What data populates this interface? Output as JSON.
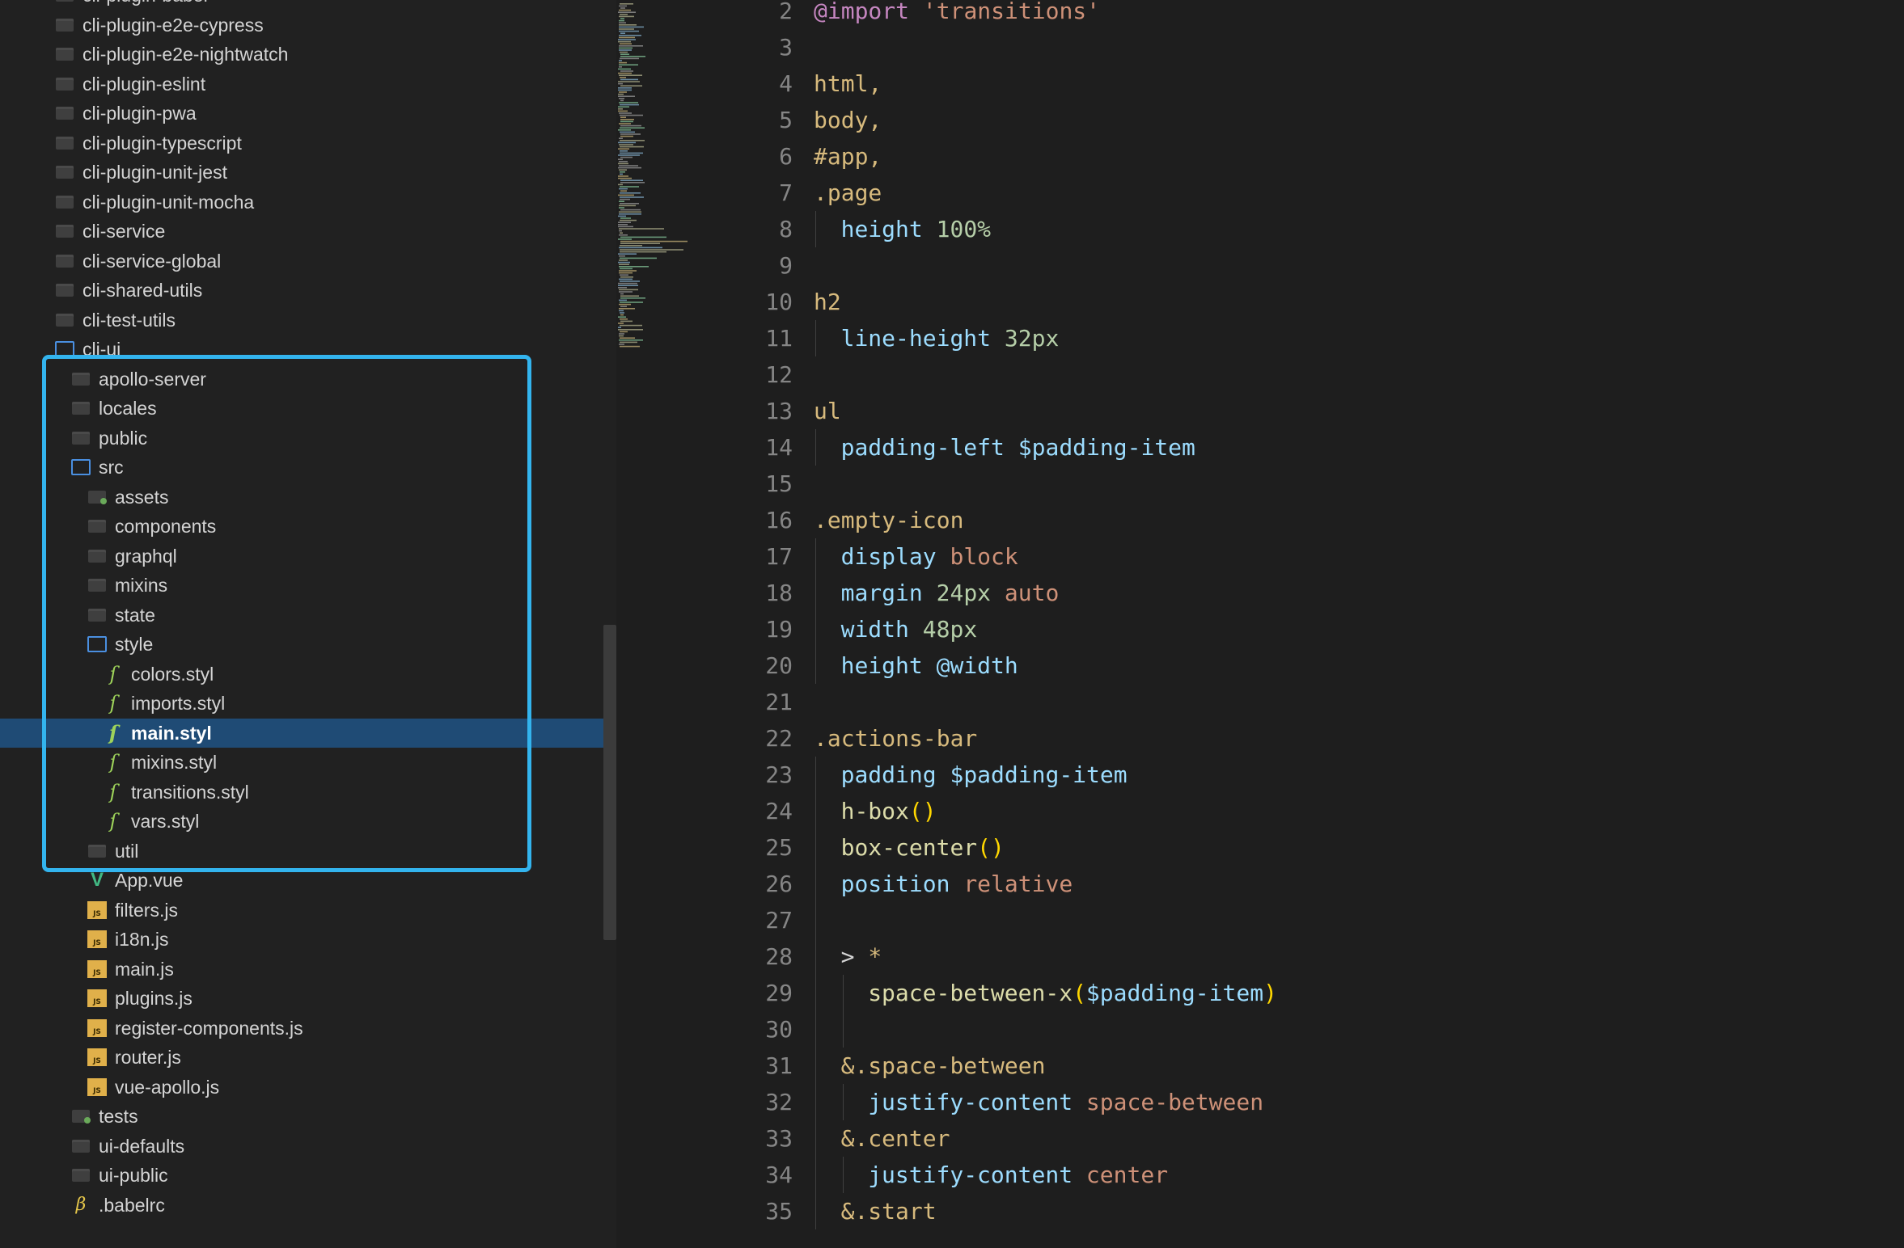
{
  "sidebar": {
    "items": [
      {
        "label": "cli-plugin-babel",
        "depth": 0,
        "icon": "folder-icon"
      },
      {
        "label": "cli-plugin-e2e-cypress",
        "depth": 0,
        "icon": "folder-icon"
      },
      {
        "label": "cli-plugin-e2e-nightwatch",
        "depth": 0,
        "icon": "folder-icon"
      },
      {
        "label": "cli-plugin-eslint",
        "depth": 0,
        "icon": "folder-icon"
      },
      {
        "label": "cli-plugin-pwa",
        "depth": 0,
        "icon": "folder-icon"
      },
      {
        "label": "cli-plugin-typescript",
        "depth": 0,
        "icon": "folder-icon"
      },
      {
        "label": "cli-plugin-unit-jest",
        "depth": 0,
        "icon": "folder-icon"
      },
      {
        "label": "cli-plugin-unit-mocha",
        "depth": 0,
        "icon": "folder-icon"
      },
      {
        "label": "cli-service",
        "depth": 0,
        "icon": "folder-icon"
      },
      {
        "label": "cli-service-global",
        "depth": 0,
        "icon": "folder-icon"
      },
      {
        "label": "cli-shared-utils",
        "depth": 0,
        "icon": "folder-icon"
      },
      {
        "label": "cli-test-utils",
        "depth": 0,
        "icon": "folder-icon"
      },
      {
        "label": "cli-ui",
        "depth": 0,
        "icon": "folder-open-icon"
      },
      {
        "label": "apollo-server",
        "depth": 1,
        "icon": "folder-icon"
      },
      {
        "label": "locales",
        "depth": 1,
        "icon": "folder-icon"
      },
      {
        "label": "public",
        "depth": 1,
        "icon": "folder-icon"
      },
      {
        "label": "src",
        "depth": 1,
        "icon": "folder-open-icon"
      },
      {
        "label": "assets",
        "depth": 2,
        "icon": "folder-tag-icon"
      },
      {
        "label": "components",
        "depth": 2,
        "icon": "folder-icon"
      },
      {
        "label": "graphql",
        "depth": 2,
        "icon": "folder-icon"
      },
      {
        "label": "mixins",
        "depth": 2,
        "icon": "folder-icon"
      },
      {
        "label": "state",
        "depth": 2,
        "icon": "folder-icon"
      },
      {
        "label": "style",
        "depth": 2,
        "icon": "folder-open-icon"
      },
      {
        "label": "colors.styl",
        "depth": 3,
        "icon": "stylus-file-icon"
      },
      {
        "label": "imports.styl",
        "depth": 3,
        "icon": "stylus-file-icon"
      },
      {
        "label": "main.styl",
        "depth": 3,
        "icon": "stylus-file-icon",
        "selected": true
      },
      {
        "label": "mixins.styl",
        "depth": 3,
        "icon": "stylus-file-icon"
      },
      {
        "label": "transitions.styl",
        "depth": 3,
        "icon": "stylus-file-icon"
      },
      {
        "label": "vars.styl",
        "depth": 3,
        "icon": "stylus-file-icon"
      },
      {
        "label": "util",
        "depth": 2,
        "icon": "folder-icon"
      },
      {
        "label": "App.vue",
        "depth": 2,
        "icon": "vue-file-icon"
      },
      {
        "label": "filters.js",
        "depth": 2,
        "icon": "js-file-icon"
      },
      {
        "label": "i18n.js",
        "depth": 2,
        "icon": "js-file-icon"
      },
      {
        "label": "main.js",
        "depth": 2,
        "icon": "js-file-icon"
      },
      {
        "label": "plugins.js",
        "depth": 2,
        "icon": "js-file-icon"
      },
      {
        "label": "register-components.js",
        "depth": 2,
        "icon": "js-file-icon"
      },
      {
        "label": "router.js",
        "depth": 2,
        "icon": "js-file-icon"
      },
      {
        "label": "vue-apollo.js",
        "depth": 2,
        "icon": "js-file-icon"
      },
      {
        "label": "tests",
        "depth": 1,
        "icon": "folder-tag-icon"
      },
      {
        "label": "ui-defaults",
        "depth": 1,
        "icon": "folder-icon"
      },
      {
        "label": "ui-public",
        "depth": 1,
        "icon": "folder-icon"
      },
      {
        "label": ".babelrc",
        "depth": 1,
        "icon": "babel-file-icon"
      }
    ]
  },
  "editor": {
    "lines": [
      {
        "n": "2",
        "indent": 0,
        "tokens": [
          [
            "at",
            "@import"
          ],
          [
            "op",
            " "
          ],
          [
            "str",
            "'transitions'"
          ]
        ]
      },
      {
        "n": "3",
        "indent": 0,
        "tokens": []
      },
      {
        "n": "4",
        "indent": 0,
        "tokens": [
          [
            "sel",
            "html,"
          ]
        ]
      },
      {
        "n": "5",
        "indent": 0,
        "tokens": [
          [
            "sel",
            "body,"
          ]
        ]
      },
      {
        "n": "6",
        "indent": 0,
        "tokens": [
          [
            "sel",
            "#app,"
          ]
        ]
      },
      {
        "n": "7",
        "indent": 0,
        "tokens": [
          [
            "sel",
            ".page"
          ]
        ]
      },
      {
        "n": "8",
        "indent": 1,
        "tokens": [
          [
            "prop",
            "height"
          ],
          [
            "op",
            " "
          ],
          [
            "num",
            "100%"
          ]
        ]
      },
      {
        "n": "9",
        "indent": 0,
        "tokens": []
      },
      {
        "n": "10",
        "indent": 0,
        "tokens": [
          [
            "sel",
            "h2"
          ]
        ]
      },
      {
        "n": "11",
        "indent": 1,
        "tokens": [
          [
            "prop",
            "line-height"
          ],
          [
            "op",
            " "
          ],
          [
            "num",
            "32px"
          ]
        ]
      },
      {
        "n": "12",
        "indent": 0,
        "tokens": []
      },
      {
        "n": "13",
        "indent": 0,
        "tokens": [
          [
            "sel",
            "ul"
          ]
        ]
      },
      {
        "n": "14",
        "indent": 1,
        "tokens": [
          [
            "prop",
            "padding-left"
          ],
          [
            "op",
            " "
          ],
          [
            "var",
            "$padding-item"
          ]
        ]
      },
      {
        "n": "15",
        "indent": 0,
        "tokens": []
      },
      {
        "n": "16",
        "indent": 0,
        "tokens": [
          [
            "sel",
            ".empty-icon"
          ]
        ]
      },
      {
        "n": "17",
        "indent": 1,
        "tokens": [
          [
            "prop",
            "display"
          ],
          [
            "op",
            " "
          ],
          [
            "kw",
            "block"
          ]
        ]
      },
      {
        "n": "18",
        "indent": 1,
        "tokens": [
          [
            "prop",
            "margin"
          ],
          [
            "op",
            " "
          ],
          [
            "num",
            "24px"
          ],
          [
            "op",
            " "
          ],
          [
            "kw",
            "auto"
          ]
        ]
      },
      {
        "n": "19",
        "indent": 1,
        "tokens": [
          [
            "prop",
            "width"
          ],
          [
            "op",
            " "
          ],
          [
            "num",
            "48px"
          ]
        ]
      },
      {
        "n": "20",
        "indent": 1,
        "tokens": [
          [
            "prop",
            "height"
          ],
          [
            "op",
            " "
          ],
          [
            "var",
            "@width"
          ]
        ]
      },
      {
        "n": "21",
        "indent": 0,
        "tokens": []
      },
      {
        "n": "22",
        "indent": 0,
        "tokens": [
          [
            "sel",
            ".actions-bar"
          ]
        ]
      },
      {
        "n": "23",
        "indent": 1,
        "tokens": [
          [
            "prop",
            "padding"
          ],
          [
            "op",
            " "
          ],
          [
            "var",
            "$padding-item"
          ]
        ]
      },
      {
        "n": "24",
        "indent": 1,
        "tokens": [
          [
            "fn",
            "h-box"
          ],
          [
            "par",
            "()"
          ]
        ]
      },
      {
        "n": "25",
        "indent": 1,
        "tokens": [
          [
            "fn",
            "box-center"
          ],
          [
            "par",
            "()"
          ]
        ]
      },
      {
        "n": "26",
        "indent": 1,
        "tokens": [
          [
            "prop",
            "position"
          ],
          [
            "op",
            " "
          ],
          [
            "kw",
            "relative"
          ]
        ]
      },
      {
        "n": "27",
        "indent": 1,
        "tokens": []
      },
      {
        "n": "28",
        "indent": 1,
        "tokens": [
          [
            "op",
            "> "
          ],
          [
            "sel",
            "*"
          ]
        ]
      },
      {
        "n": "29",
        "indent": 2,
        "tokens": [
          [
            "fn",
            "space-between-x"
          ],
          [
            "par",
            "("
          ],
          [
            "var",
            "$padding-item"
          ],
          [
            "par",
            ")"
          ]
        ]
      },
      {
        "n": "30",
        "indent": 2,
        "tokens": []
      },
      {
        "n": "31",
        "indent": 1,
        "tokens": [
          [
            "sel",
            "&.space-between"
          ]
        ]
      },
      {
        "n": "32",
        "indent": 2,
        "tokens": [
          [
            "prop",
            "justify-content"
          ],
          [
            "op",
            " "
          ],
          [
            "kw",
            "space-between"
          ]
        ]
      },
      {
        "n": "33",
        "indent": 1,
        "tokens": [
          [
            "sel",
            "&.center"
          ]
        ]
      },
      {
        "n": "34",
        "indent": 2,
        "tokens": [
          [
            "prop",
            "justify-content"
          ],
          [
            "op",
            " "
          ],
          [
            "kw",
            "center"
          ]
        ]
      },
      {
        "n": "35",
        "indent": 1,
        "tokens": [
          [
            "sel",
            "&.start"
          ]
        ]
      }
    ]
  },
  "colors": {
    "selection": "#1f4b75",
    "highlight_box": "#33b4ee",
    "background": "#1e1e1e"
  }
}
